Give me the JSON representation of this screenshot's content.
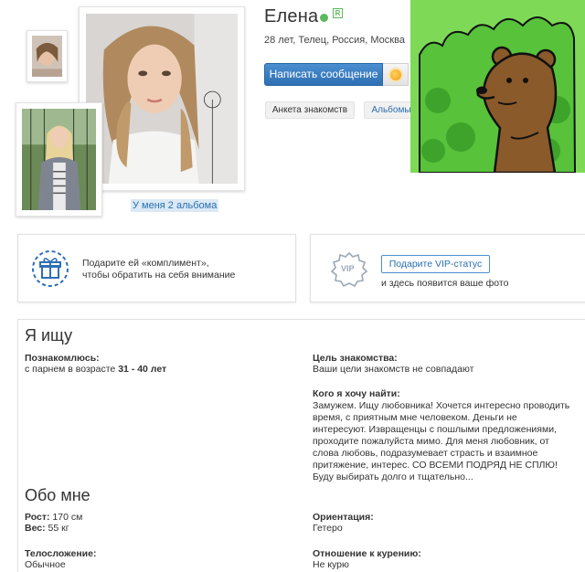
{
  "profile": {
    "name": "Елена",
    "meta": "28 лет, Телец, Россия, Москва",
    "albums_link": "У меня 2 альбома",
    "registered_badge": "R"
  },
  "actions": {
    "message_button": "Написать сообщение",
    "tabs": [
      {
        "label": "Анкета знакомств"
      },
      {
        "label": "Альбомы"
      }
    ]
  },
  "promo": {
    "compliment_text": "Подарите ей «комплимент», чтобы обратить на себя внимание",
    "vip_icon_label": "VIP",
    "vip_button": "Подарите VIP-статус",
    "vip_note": "и здесь появится ваше фото"
  },
  "looking_for": {
    "title": "Я ищу",
    "meet_label": "Познакомлюсь:",
    "meet_prefix": "с парнем в возрасте",
    "meet_age": "31 - 40 лет",
    "goal_label": "Цель знакомства:",
    "goal_value": "Ваши цели знакомств не совпадают",
    "whom_label": "Кого я хочу найти:",
    "whom_text": "Замужем. Ищу любовника! Хочется интересно проводить время, с приятным мне человеком. Деньги не интересуют. Извращенцы с пошлыми предложениями, проходите пожалуйста мимо. Для меня любовник, от слова любовь, подразумевает страсть и взаимное притяжение, интерес. СО ВСЕМИ ПОДРЯД НЕ СПЛЮ! Буду выбирать долго и тщательно..."
  },
  "about": {
    "title": "Обо мне",
    "height_label": "Рост:",
    "height_value": "170 см",
    "weight_label": "Вес:",
    "weight_value": "55 кг",
    "orientation_label": "Ориентация:",
    "orientation_value": "Гетеро",
    "build_label": "Телосложение:",
    "build_value": "Обычное",
    "smoking_label": "Отношение к курению:",
    "smoking_value": "Не курю"
  },
  "colors": {
    "accent": "#2f6fb3",
    "online": "#5cb85c",
    "meme_background": "#7ed957"
  }
}
